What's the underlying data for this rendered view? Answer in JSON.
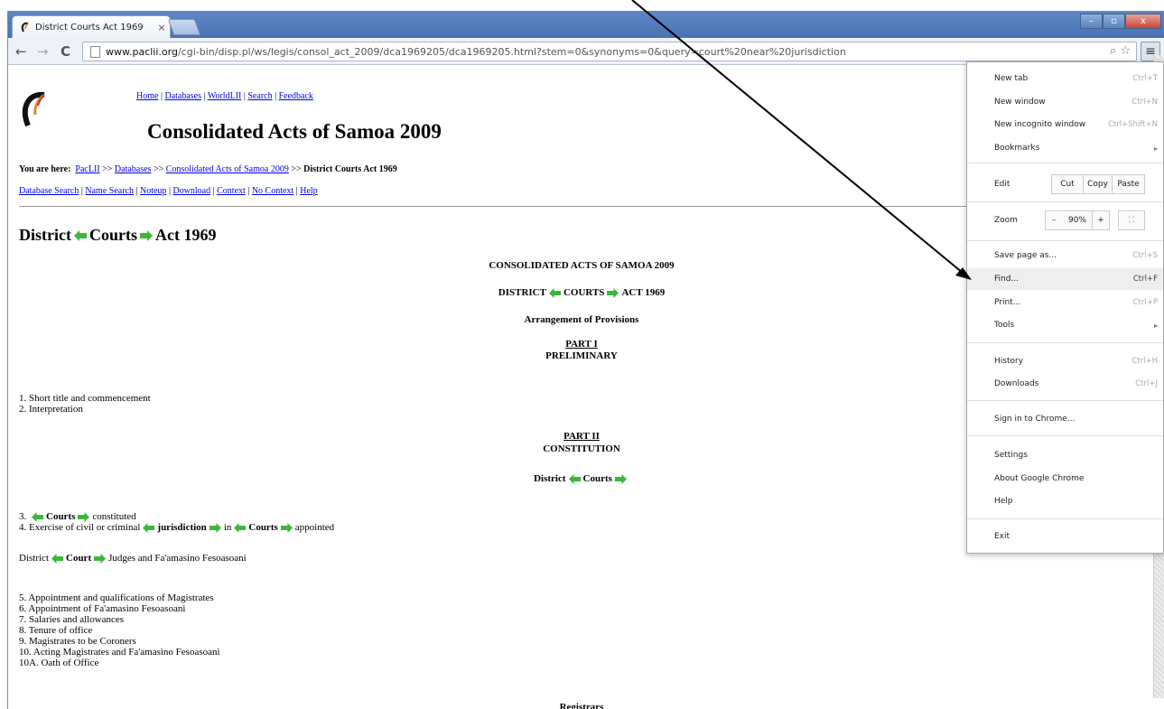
{
  "browser": {
    "tab_title": "District Courts Act 1969",
    "tab_close": "×",
    "url_host": "www.paclii.org",
    "url_path": "/cgi-bin/disp.pl/ws/legis/consol_act_2009/dca1969205/dca1969205.html?stem=0&synonyms=0&query=court%20near%20jurisdiction",
    "minimize": "–",
    "maximize": "▫",
    "close": "x",
    "back": "←",
    "forward": "→",
    "reload": "C",
    "menu_icon": "≡",
    "search_icon": "⌕",
    "star_icon": "☆"
  },
  "page": {
    "logo_text": "PacLII",
    "topnav": [
      "Home",
      "Databases",
      "WorldLII",
      "Search",
      "Feedback"
    ],
    "site_title": "Consolidated Acts of Samoa 2009",
    "crumbs_label": "You are here:",
    "crumbs": [
      "PacLII",
      "Databases",
      "Consolidated Acts of Samoa 2009"
    ],
    "crumbs_sep": ">>",
    "crumbs_current": "District Courts Act 1969",
    "dblinks": [
      "Database Search",
      "Name Search",
      "Noteup",
      "Download",
      "Context",
      "No Context",
      "Help"
    ],
    "doc_title": [
      "District",
      "Courts",
      "Act 1969"
    ],
    "heading1": "CONSOLIDATED ACTS OF SAMOA 2009",
    "heading2": [
      "DISTRICT",
      "COURTS",
      "ACT 1969"
    ],
    "heading3": "Arrangement of Provisions",
    "part1_label": "PART I",
    "part1_title": "PRELIMINARY",
    "part1_items": [
      "1. Short title and commencement",
      "2. Interpretation"
    ],
    "part2_label": "PART II",
    "part2_title": "CONSTITUTION",
    "part2_sub": [
      "District",
      "Courts"
    ],
    "item3": [
      "3.",
      "Courts",
      "constituted"
    ],
    "item4": [
      "4. Exercise of civil or criminal",
      "jurisdiction",
      "in",
      "Courts",
      "appointed"
    ],
    "judges_line": [
      "District",
      "Court",
      "Judges and Fa'amasino Fesoasoani"
    ],
    "items_5_10": [
      "5. Appointment and qualifications of Magistrates",
      "6. Appointment of Fa'amasino Fesoasoani",
      "7. Salaries and allowances",
      "8. Tenure of office",
      "9. Magistrates to be Coroners",
      "10. Acting Magistrates and Fa'amasino Fesoasoani",
      "10A. Oath of Office"
    ],
    "registrars": "Registrars"
  },
  "menu": {
    "new_tab": "New tab",
    "new_tab_sc": "Ctrl+T",
    "new_window": "New window",
    "new_window_sc": "Ctrl+N",
    "incognito": "New incognito window",
    "incognito_sc": "Ctrl+Shift+N",
    "bookmarks": "Bookmarks",
    "edit": "Edit",
    "cut": "Cut",
    "copy": "Copy",
    "paste": "Paste",
    "zoom": "Zoom",
    "zoom_minus": "–",
    "zoom_value": "90%",
    "zoom_plus": "+",
    "fullscreen": "⛶",
    "save_page": "Save page as...",
    "save_page_sc": "Ctrl+S",
    "find": "Find...",
    "find_sc": "Ctrl+F",
    "print": "Print...",
    "print_sc": "Ctrl+P",
    "tools": "Tools",
    "history": "History",
    "history_sc": "Ctrl+H",
    "downloads": "Downloads",
    "downloads_sc": "Ctrl+J",
    "sign_in": "Sign in to Chrome...",
    "settings": "Settings",
    "about": "About Google Chrome",
    "help": "Help",
    "exit": "Exit",
    "submenu_arrow": "▸"
  },
  "colors": {
    "hit_arrow": "#3cb838",
    "link": "#0000ee",
    "tabstrip": "#5f86c4"
  }
}
